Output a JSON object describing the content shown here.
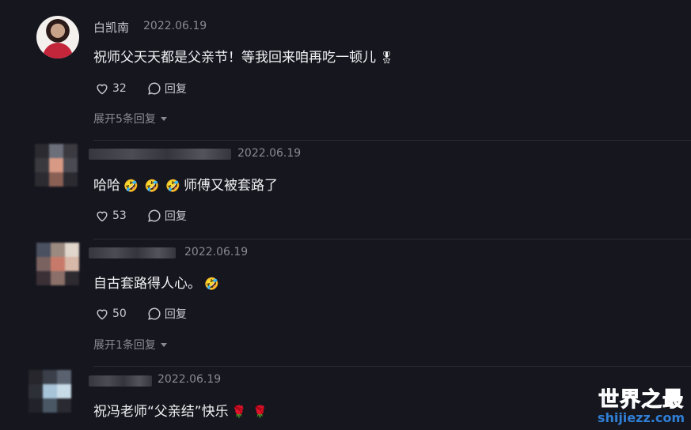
{
  "comments": [
    {
      "user": "白凯南",
      "date": "2022.06.19",
      "text": "祝师父天天都是父亲节！等我回来咱再吃一顿儿",
      "emoji": "🎖",
      "likes": "32",
      "reply_label": "回复",
      "expand_label": "展开5条回复"
    },
    {
      "date": "2022.06.19",
      "text_prefix": "哈哈",
      "emojis": [
        "🤣",
        "🤣",
        "🤣"
      ],
      "text": "师傅又被套路了",
      "likes": "53",
      "reply_label": "回复"
    },
    {
      "date": "2022.06.19",
      "text": "自古套路得人心。",
      "emoji": "🤣",
      "likes": "50",
      "reply_label": "回复",
      "expand_label": "展开1条回复"
    },
    {
      "date": "2022.06.19",
      "text": "祝冯老师“父亲结”快乐",
      "emojis": [
        "🌹",
        "🌹"
      ]
    }
  ],
  "watermark": {
    "title": "世界之最",
    "url": "shijiezz.com"
  },
  "icons": {
    "like": "heart-icon",
    "reply": "comment-bubble-icon",
    "expand": "caret-down-icon"
  }
}
